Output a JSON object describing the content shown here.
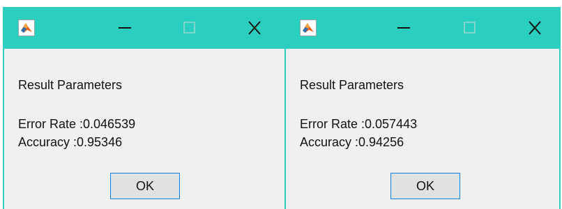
{
  "colors": {
    "titlebar": "#2bcfbf",
    "dialog_background": "#f0f0f0",
    "button_border": "#1e7fd6"
  },
  "icons": {
    "app": "matlab-logo-icon",
    "minimize": "minimize-icon",
    "maximize": "maximize-icon",
    "close": "close-icon"
  },
  "dialogs": [
    {
      "heading": "Result Parameters",
      "error_rate": "Error Rate :0.046539",
      "accuracy": "Accuracy :0.95346",
      "ok_label": "OK"
    },
    {
      "heading": "Result Parameters",
      "error_rate": "Error Rate :0.057443",
      "accuracy": "Accuracy :0.94256",
      "ok_label": "OK"
    }
  ]
}
